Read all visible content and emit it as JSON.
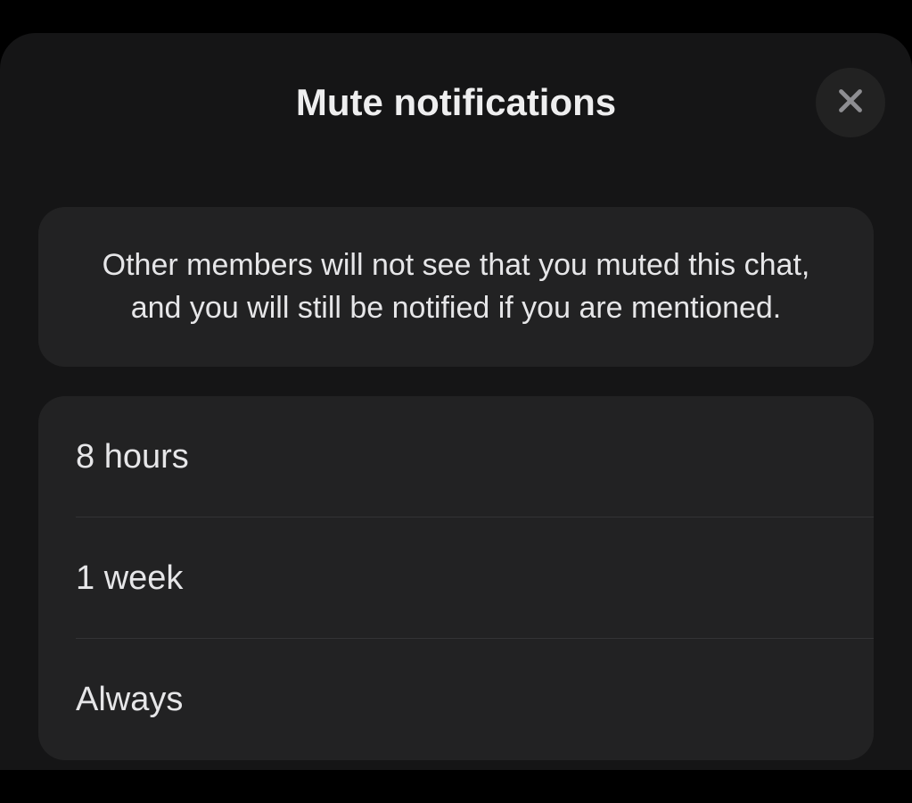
{
  "modal": {
    "title": "Mute notifications",
    "info_text": "Other members will not see that you muted this chat, and you will still be notified if you are mentioned.",
    "options": [
      {
        "label": "8 hours"
      },
      {
        "label": "1 week"
      },
      {
        "label": "Always"
      }
    ]
  }
}
